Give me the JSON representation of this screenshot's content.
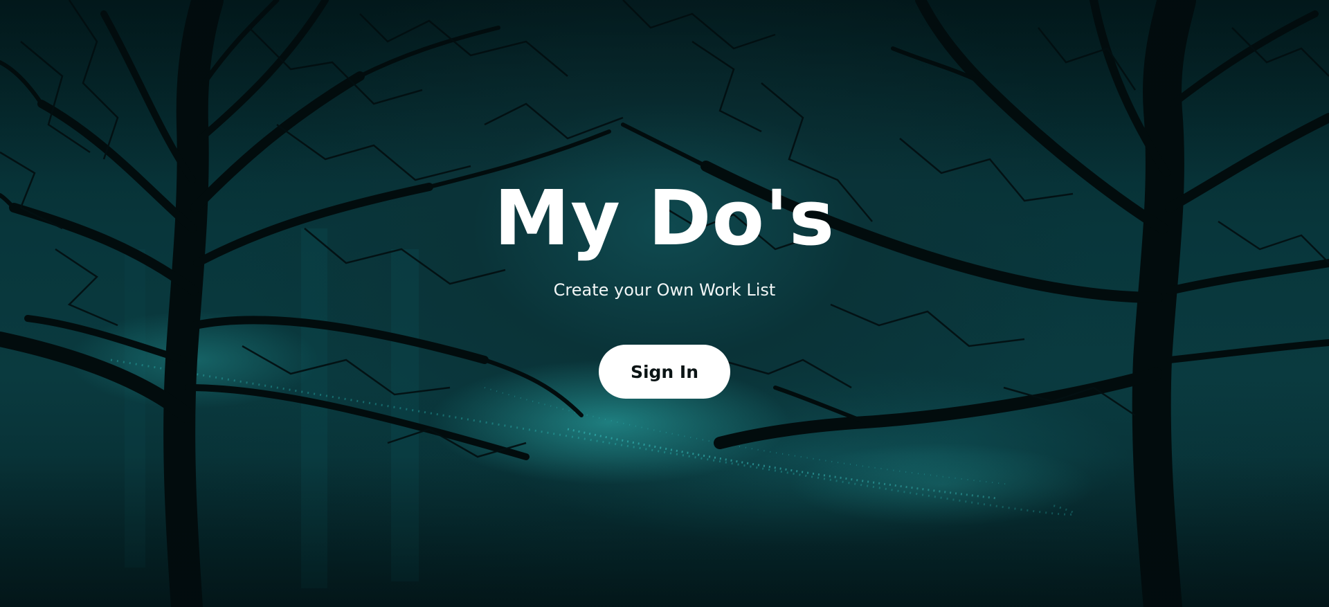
{
  "hero": {
    "title": "My Do's",
    "subtitle": "Create your Own Work List",
    "signin_label": "Sign In"
  },
  "background": {
    "description_icon": "bare-trees-foggy-night",
    "colors": {
      "sky": "#0a3a3f",
      "dark": "#03181b",
      "tree": "#020c0d",
      "lights": "#3fd2d0"
    }
  },
  "colors": {
    "title": "#ffffff",
    "button_bg": "#ffffff",
    "button_text": "#0b1415"
  }
}
